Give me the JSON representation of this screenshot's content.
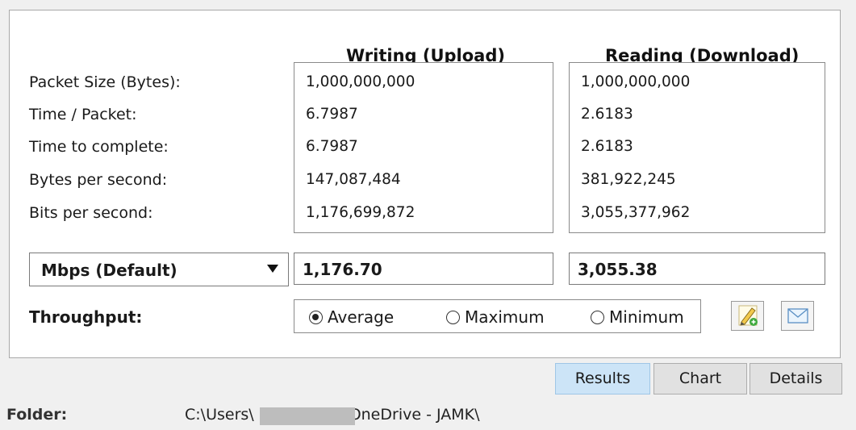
{
  "columns": {
    "upload_header": "Writing (Upload)",
    "download_header": "Reading (Download)"
  },
  "rows": [
    {
      "label": "Packet Size (Bytes):",
      "upload": "1,000,000,000",
      "download": "1,000,000,000"
    },
    {
      "label": "Time / Packet:",
      "upload": "6.7987",
      "download": "2.6183"
    },
    {
      "label": "Time to complete:",
      "upload": "6.7987",
      "download": "2.6183"
    },
    {
      "label": "Bytes per second:",
      "upload": "147,087,484",
      "download": "381,922,245"
    },
    {
      "label": "Bits per second:",
      "upload": "1,176,699,872",
      "download": "3,055,377,962"
    }
  ],
  "unit_select": {
    "selected": "Mbps (Default)",
    "icon": "chevron-down-icon"
  },
  "results": {
    "upload": "1,176.70",
    "download": "3,055.38"
  },
  "throughput": {
    "label": "Throughput:",
    "options": [
      "Average",
      "Maximum",
      "Minimum"
    ],
    "selected": "Average"
  },
  "actions": {
    "edit_icon": "pencil-add-icon",
    "email_icon": "envelope-icon"
  },
  "tabs": [
    {
      "label": "Results",
      "active": true
    },
    {
      "label": "Chart",
      "active": false
    },
    {
      "label": "Details",
      "active": false
    }
  ],
  "footer": {
    "label": "Folder:",
    "path_start": "C:\\Users\\",
    "path_end": "OneDrive - JAMK\\"
  },
  "colors": {
    "active_tab": "#cce4f7",
    "panel_border": "#a9a9a9",
    "background": "#f0f0f0"
  }
}
